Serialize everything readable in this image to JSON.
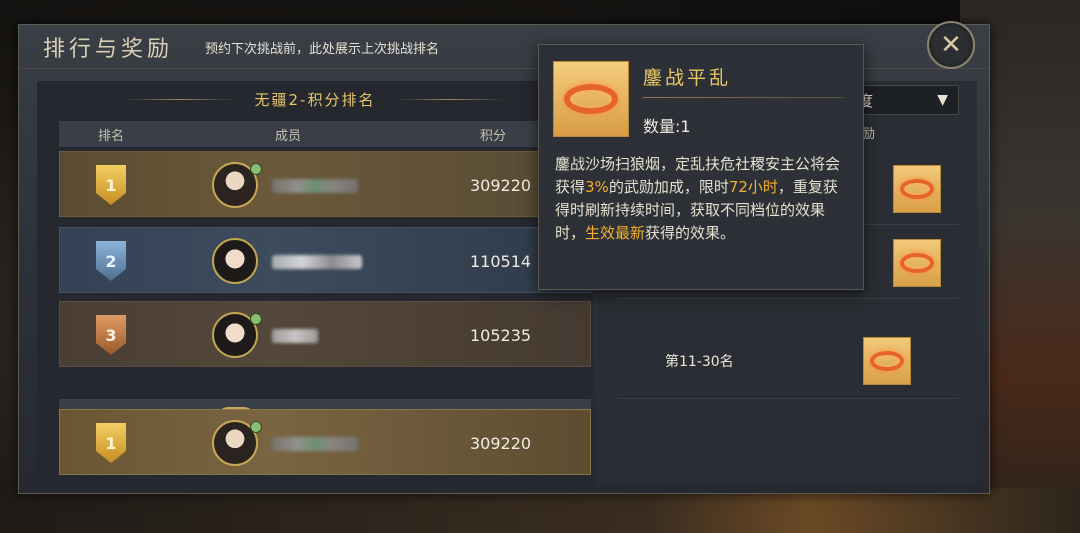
{
  "header": {
    "title": "排行与奖励",
    "subtitle": "预约下次挑战前，此处展示上次挑战排名"
  },
  "leaderboard": {
    "title": "无疆2-积分排名",
    "columns": {
      "rank": "排名",
      "member": "成员",
      "score": "积分"
    },
    "rows": [
      {
        "rank": "1",
        "score": "309220"
      },
      {
        "rank": "2",
        "score": "110514"
      },
      {
        "rank": "3",
        "score": "105235"
      }
    ],
    "self_row": {
      "rank": "1",
      "score": "309220"
    }
  },
  "rewards": {
    "dropdown_value": "度",
    "column_reward": "奖励",
    "rows": [
      {
        "label": "第11-30名"
      }
    ]
  },
  "tooltip": {
    "item_name": "鏖战平乱",
    "quantity": "数量:1",
    "desc_1": "鏖战沙场扫狼烟，定乱扶危社稷安主公将会获得",
    "desc_hl_1": "3%",
    "desc_2": "的武勋加成，限时",
    "desc_hl_2": "72小时",
    "desc_3": "，重复获得时刷新持续时间，获取不同档位的效果时，",
    "desc_hl_3": "生效最新",
    "desc_4": "获得的效果。"
  },
  "icons": {
    "close": "close-crossed-swords-icon",
    "chevron": "chevron-down-icon",
    "reward_item": "ring-icon"
  },
  "colors": {
    "accent_gold": "#e8c766",
    "highlight": "#f2b030",
    "gold_row": "#6b593a",
    "silver_row": "#3d4b5d",
    "bronze_row": "#54473b"
  }
}
